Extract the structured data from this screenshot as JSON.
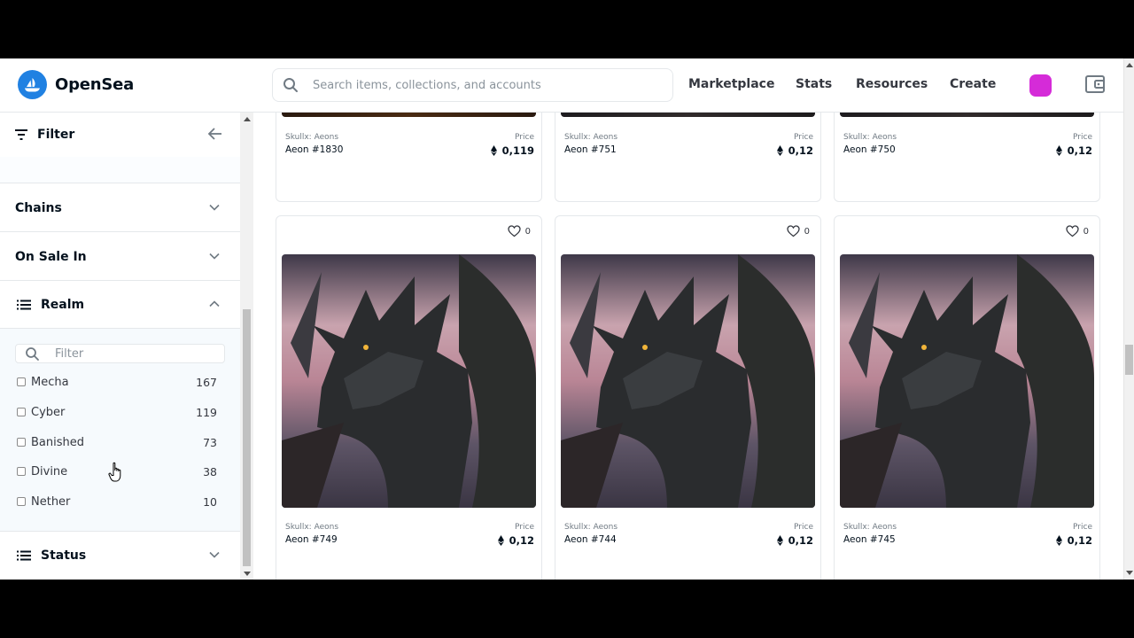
{
  "header": {
    "brand": "OpenSea",
    "search_placeholder": "Search items, collections, and accounts",
    "nav": [
      "Marketplace",
      "Stats",
      "Resources",
      "Create"
    ],
    "avatar_color": "#d52bd8"
  },
  "sidebar": {
    "filter_label": "Filter",
    "sections": {
      "chains": "Chains",
      "on_sale_in": "On Sale In",
      "realm": "Realm",
      "status": "Status"
    },
    "realm_filter_placeholder": "Filter",
    "realm_items": [
      {
        "label": "Mecha",
        "count": "167"
      },
      {
        "label": "Cyber",
        "count": "119"
      },
      {
        "label": "Banished",
        "count": "73"
      },
      {
        "label": "Divine",
        "count": "38"
      },
      {
        "label": "Nether",
        "count": "10"
      }
    ]
  },
  "grid": {
    "price_label": "Price",
    "top_row": [
      {
        "collection": "Skullx: Aeons",
        "name": "Aeon #1830",
        "price": "0,119"
      },
      {
        "collection": "Skullx: Aeons",
        "name": "Aeon #751",
        "price": "0,12"
      },
      {
        "collection": "Skullx: Aeons",
        "name": "Aeon #750",
        "price": "0,12"
      }
    ],
    "second_row": [
      {
        "collection": "Skullx: Aeons",
        "name": "Aeon #749",
        "price": "0,12",
        "favorites": "0"
      },
      {
        "collection": "Skullx: Aeons",
        "name": "Aeon #744",
        "price": "0,12",
        "favorites": "0"
      },
      {
        "collection": "Skullx: Aeons",
        "name": "Aeon #745",
        "price": "0,12",
        "favorites": "0"
      }
    ]
  },
  "colors": {
    "brand_blue": "#2081e2",
    "text_primary": "#04111d",
    "border": "#e5e8eb"
  },
  "icons": [
    "opensea-logo-icon",
    "search-icon",
    "wallet-icon",
    "filter-icon",
    "arrow-left-icon",
    "chevron-down-icon",
    "chevron-up-icon",
    "list-icon",
    "heart-icon",
    "ethereum-icon",
    "hand-cursor-icon"
  ]
}
